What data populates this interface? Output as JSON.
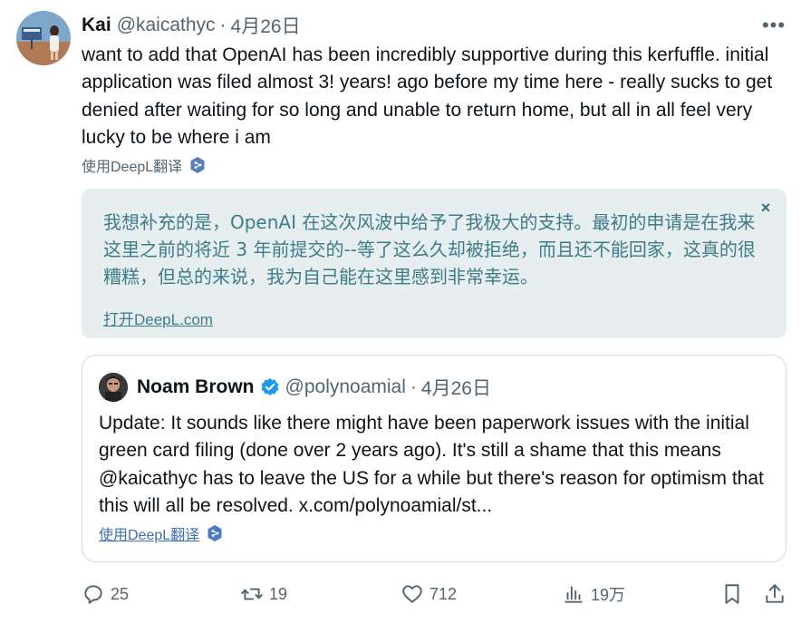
{
  "tweet": {
    "name": "Kai",
    "handle": "@kaicathyc",
    "separator": "·",
    "date": "4月26日",
    "more_label": "•••",
    "text": "want to add that OpenAI has been incredibly supportive during this kerfuffle. initial application was filed almost 3! years! ago  before my time here - really sucks to get denied after waiting for so long and unable to return home, but all in all feel very lucky to be where i am",
    "translate_label": "使用DeepL翻译"
  },
  "translation": {
    "text": "我想补充的是，OpenAI 在这次风波中给予了我极大的支持。最初的申请是在我来这里之前的将近 3 年前提交的--等了这么久却被拒绝，而且还不能回家，这真的很糟糕，但总的来说，我为自己能在这里感到非常幸运。",
    "close_label": "×",
    "open_link": "打开DeepL.com"
  },
  "quote": {
    "name": "Noam Brown",
    "handle": "@polynoamial",
    "separator": "·",
    "date": "4月26日",
    "text": "Update: It sounds like there might have been paperwork issues with the initial green card filing (done over 2 years ago). It's still a shame that this means @kaicathyc has to leave the US for a while but there's reason for optimism that this will all be resolved. x.com/polynoamial/st...",
    "translate_label": "使用DeepL翻译"
  },
  "actions": {
    "replies": "25",
    "retweets": "19",
    "likes": "712",
    "views": "19万"
  },
  "icons": {
    "reply": "reply-icon",
    "retweet": "retweet-icon",
    "like": "heart-icon",
    "views": "views-icon",
    "bookmark": "bookmark-icon",
    "share": "share-icon",
    "deepl": "deepl-icon",
    "verified": "verified-badge-icon"
  },
  "colors": {
    "text": "#0f1419",
    "muted": "#536471",
    "verified": "#1d9bf0",
    "translation_bg": "#e6eef0",
    "translation_text": "#3f7c8a",
    "deepl": "#4a7ac4"
  }
}
